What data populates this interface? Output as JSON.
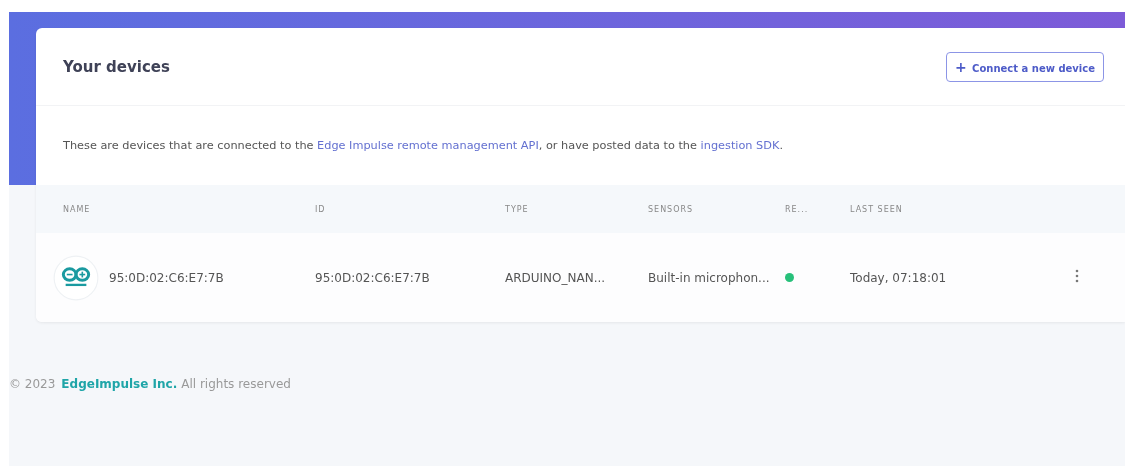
{
  "card": {
    "title": "Your devices",
    "connect_button": {
      "icon": "+",
      "label": "Connect a new device"
    },
    "description": [
      "These are devices that are connected to the ",
      "Edge Impulse remote management API",
      ", or have posted data to the ",
      "ingestion SDK",
      "."
    ]
  },
  "table": {
    "columns": [
      "NAME",
      "ID",
      "TYPE",
      "SENSORS",
      "RE...",
      "LAST SEEN"
    ],
    "rows": [
      {
        "name": "95:0D:02:C6:E7:7B",
        "id": "95:0D:02:C6:E7:7B",
        "type": "ARDUINO_NAN...",
        "sensors": "Built-in microphon...",
        "online": true,
        "last_seen": "Today, 07:18:01"
      }
    ]
  },
  "footer": {
    "copyright": "© 2023",
    "company": "EdgeImpulse Inc.",
    "rights": "All rights reserved"
  }
}
